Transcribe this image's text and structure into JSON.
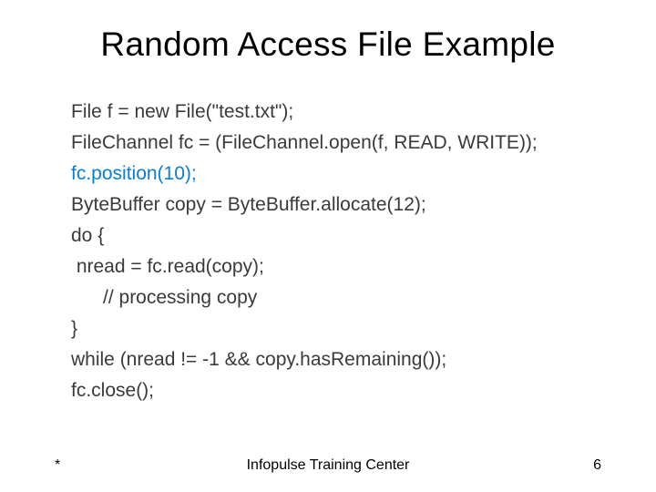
{
  "title": "Random Access File Example",
  "code": {
    "l1": "File f = new File(\"test.txt\");",
    "l2": "FileChannel fc = (FileChannel.open(f, READ, WRITE));",
    "l3": "fc.position(10);",
    "l4": "ByteBuffer copy = ByteBuffer.allocate(12);",
    "l5": "do {",
    "l6": " nread = fc.read(copy);",
    "l7": "      // processing copy",
    "l8": "}",
    "l9": "while (nread != -1 && copy.hasRemaining());",
    "l10": "fc.close();"
  },
  "footer": {
    "left": "*",
    "center": "Infopulse Training Center",
    "right": "6"
  }
}
